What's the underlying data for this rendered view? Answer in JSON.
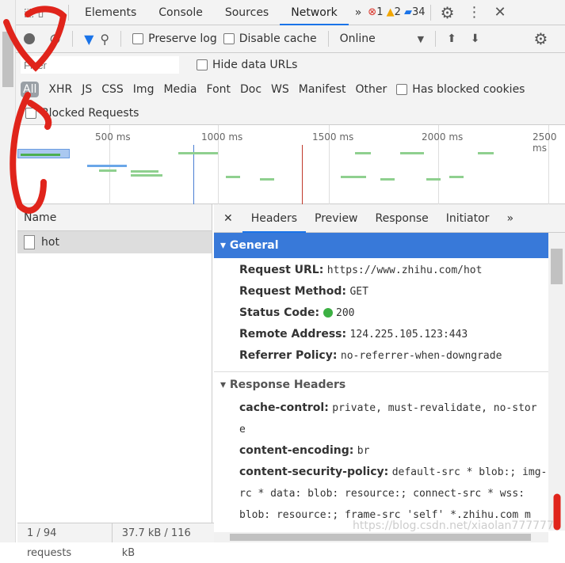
{
  "tabbar": {
    "tabs": [
      "Elements",
      "Console",
      "Sources",
      "Network"
    ],
    "active": "Network",
    "more": "»",
    "errors": "1",
    "warnings": "2",
    "messages": "34"
  },
  "toolbar": {
    "preserve_log": "Preserve log",
    "disable_cache": "Disable cache",
    "throttling": "Online"
  },
  "filter": {
    "placeholder": "Filter",
    "hide_data_urls": "Hide data URLs",
    "types": [
      "All",
      "XHR",
      "JS",
      "CSS",
      "Img",
      "Media",
      "Font",
      "Doc",
      "WS",
      "Manifest",
      "Other"
    ],
    "has_blocked_cookies": "Has blocked cookies",
    "blocked_requests": "Blocked Requests"
  },
  "overview": {
    "ticks": [
      "500 ms",
      "1000 ms",
      "1500 ms",
      "2000 ms",
      "2500 ms"
    ]
  },
  "requests": {
    "header": "Name",
    "items": [
      "hot"
    ],
    "footer_count": "1 / 94 requests",
    "footer_size": "37.7 kB / 116 kB"
  },
  "details": {
    "tabs": [
      "Headers",
      "Preview",
      "Response",
      "Initiator"
    ],
    "active": "Headers",
    "more": "»",
    "general_title": "General",
    "general": [
      {
        "k": "Request URL:",
        "v": "https://www.zhihu.com/hot"
      },
      {
        "k": "Request Method:",
        "v": "GET"
      },
      {
        "k": "Status Code:",
        "v": "200"
      },
      {
        "k": "Remote Address:",
        "v": "124.225.105.123:443"
      },
      {
        "k": "Referrer Policy:",
        "v": "no-referrer-when-downgrade"
      }
    ],
    "response_title": "Response Headers",
    "response_lines": [
      {
        "k": "cache-control:",
        "v": "private, must-revalidate, no-stor"
      },
      {
        "k": "",
        "v": "e"
      },
      {
        "k": "content-encoding:",
        "v": "br"
      },
      {
        "k": "content-security-policy:",
        "v": "default-src * blob:; img-s"
      },
      {
        "k": "",
        "v": "rc * data: blob: resource:; connect-src * wss:"
      },
      {
        "k": "",
        "v": "blob: resource:; frame-src 'self' *.zhihu.com m"
      }
    ]
  },
  "watermark": "https://blog.csdn.net/xiaolan7777777",
  "colors": {
    "accent": "#1a73e8",
    "general_bg": "#3879d9",
    "annotation": "#e0241b",
    "status_ok": "#3cb043"
  }
}
